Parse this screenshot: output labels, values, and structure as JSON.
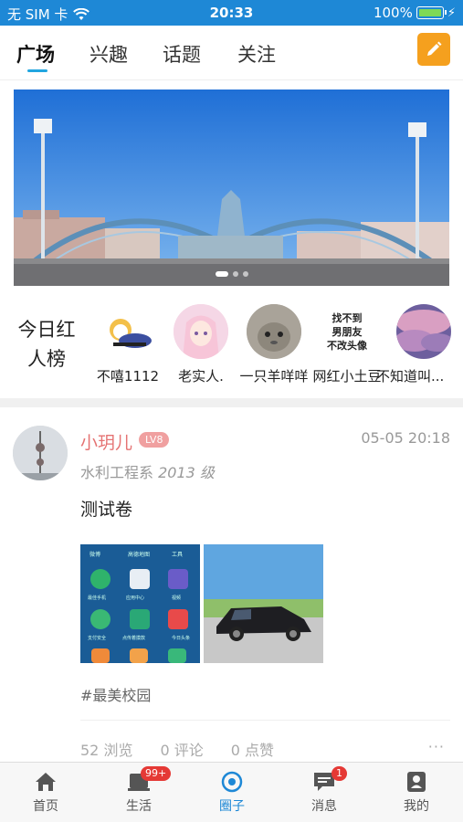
{
  "status_bar": {
    "carrier": "无 SIM 卡",
    "time": "20:33",
    "battery": "100%",
    "battery_level": 1.0
  },
  "tabs": [
    {
      "label": "广场",
      "active": true
    },
    {
      "label": "兴趣",
      "active": false
    },
    {
      "label": "话题",
      "active": false
    },
    {
      "label": "关注",
      "active": false
    }
  ],
  "banner": {
    "page_count": 3,
    "current_page": 1
  },
  "red_list": {
    "title": "今日红人榜",
    "users": [
      {
        "name": "不嘻1112"
      },
      {
        "name": "老实人."
      },
      {
        "name": "一只羊咩咩"
      },
      {
        "name": "网红小土豆",
        "avatar_text": "找不到\n男朋友\n不改头像"
      },
      {
        "name": "不知道叫..."
      }
    ]
  },
  "post": {
    "author": "小玥儿",
    "level": "LV8",
    "time": "05-05 20:18",
    "department": "水利工程系",
    "grade": "2013 级",
    "content": "测试卷",
    "tag": "#最美校园",
    "views": "52 浏览",
    "comments": "0 评论",
    "likes": "0 点赞",
    "more": "···",
    "phone_screen_labels": [
      "微博",
      "高德地图",
      "工具",
      "最佳手机",
      "应用中心",
      "视频",
      "支付安全",
      "点传着摸款",
      "今日头条"
    ]
  },
  "bottom_nav": [
    {
      "label": "首页",
      "icon": "home-icon",
      "active": false,
      "badge": ""
    },
    {
      "label": "生活",
      "icon": "life-icon",
      "active": false,
      "badge": "99+"
    },
    {
      "label": "圈子",
      "icon": "circle-icon",
      "active": true,
      "badge": ""
    },
    {
      "label": "消息",
      "icon": "message-icon",
      "active": false,
      "badge": "1"
    },
    {
      "label": "我的",
      "icon": "profile-icon",
      "active": false,
      "badge": ""
    }
  ],
  "colors": {
    "status_bar": "#1e88d6",
    "accent": "#22a6e0",
    "edit_button": "#f5a01e",
    "author_name": "#e57373",
    "badge": "#e53935"
  }
}
